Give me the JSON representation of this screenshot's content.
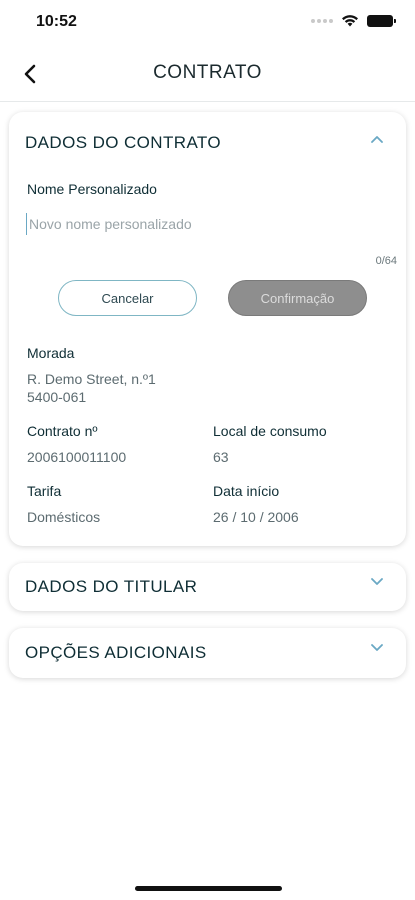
{
  "status": {
    "time": "10:52"
  },
  "nav": {
    "title": "CONTRATO"
  },
  "contract": {
    "section_title": "DADOS DO CONTRATO",
    "custom_name_label": "Nome Personalizado",
    "custom_name_placeholder": "Novo nome personalizado",
    "custom_name_value": "",
    "char_counter": "0/64",
    "cancel_label": "Cancelar",
    "confirm_label": "Confirmação",
    "address_label": "Morada",
    "address_line1": "R. Demo Street, n.º1",
    "address_line2": "5400-061",
    "contract_no_label": "Contrato nº",
    "contract_no_value": "2006100011100",
    "consumption_label": "Local de consumo",
    "consumption_value": "63",
    "tariff_label": "Tarifa",
    "tariff_value": "Domésticos",
    "start_date_label": "Data início",
    "start_date_value": "26 / 10 / 2006"
  },
  "titular": {
    "section_title": "DADOS DO TITULAR"
  },
  "options": {
    "section_title": "OPÇÕES ADICIONAIS"
  },
  "colors": {
    "accent": "#7fb6c4",
    "text_primary": "#0f2e35",
    "text_secondary": "#5c6b70",
    "confirm_disabled": "#8e8e8e"
  },
  "icons": {
    "back": "chevron-left-icon",
    "expand": "chevron-down-icon",
    "collapse": "chevron-up-icon"
  }
}
